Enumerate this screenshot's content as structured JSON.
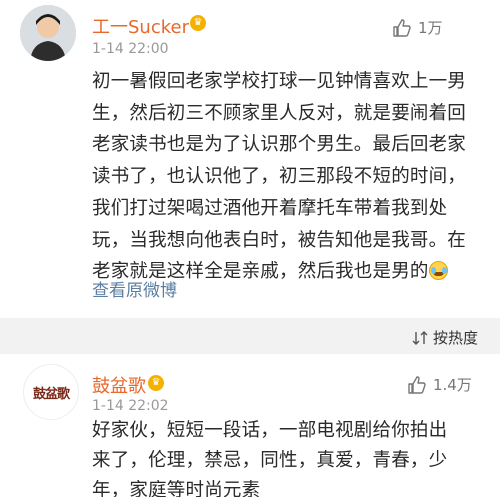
{
  "comments": [
    {
      "username": "工一Sucker",
      "timestamp": "1-14 22:00",
      "likes": "1万",
      "lines": [
        "初一暑假回老家学校打球一见钟情喜欢上一男",
        "生，然后初三不顾家里人反对，就是要闹着回",
        "老家读书也是为了认识那个男生。最后回老家",
        "读书了，也认识他了，初三那段不短的时间，",
        "我们打过架喝过酒他开着摩托车带着我到处",
        "玩，当我想向他表白时，被告知他是我哥。在",
        "老家就是这样全是亲戚，然后我也是男的"
      ],
      "emoji": "cry-laugh-emoji",
      "view_original": "查看原微博"
    },
    {
      "username": "鼓盆歌",
      "avatar_text": "鼓盆歌",
      "timestamp": "1-14 22:02",
      "likes": "1.4万",
      "lines": [
        "好家伙，短短一段话，一部电视剧给你拍出",
        "来了，伦理，禁忌，同性，真爱，青春，少",
        "年，家庭等时尚元素"
      ]
    }
  ],
  "sort": {
    "label": "按热度",
    "icon": "sort-icon"
  },
  "badge_icon": "vip-crown-icon",
  "colors": {
    "username": "#e8692a",
    "link": "#5b7ea3",
    "timestamp": "#999999",
    "divider": "#f2f2f2"
  }
}
